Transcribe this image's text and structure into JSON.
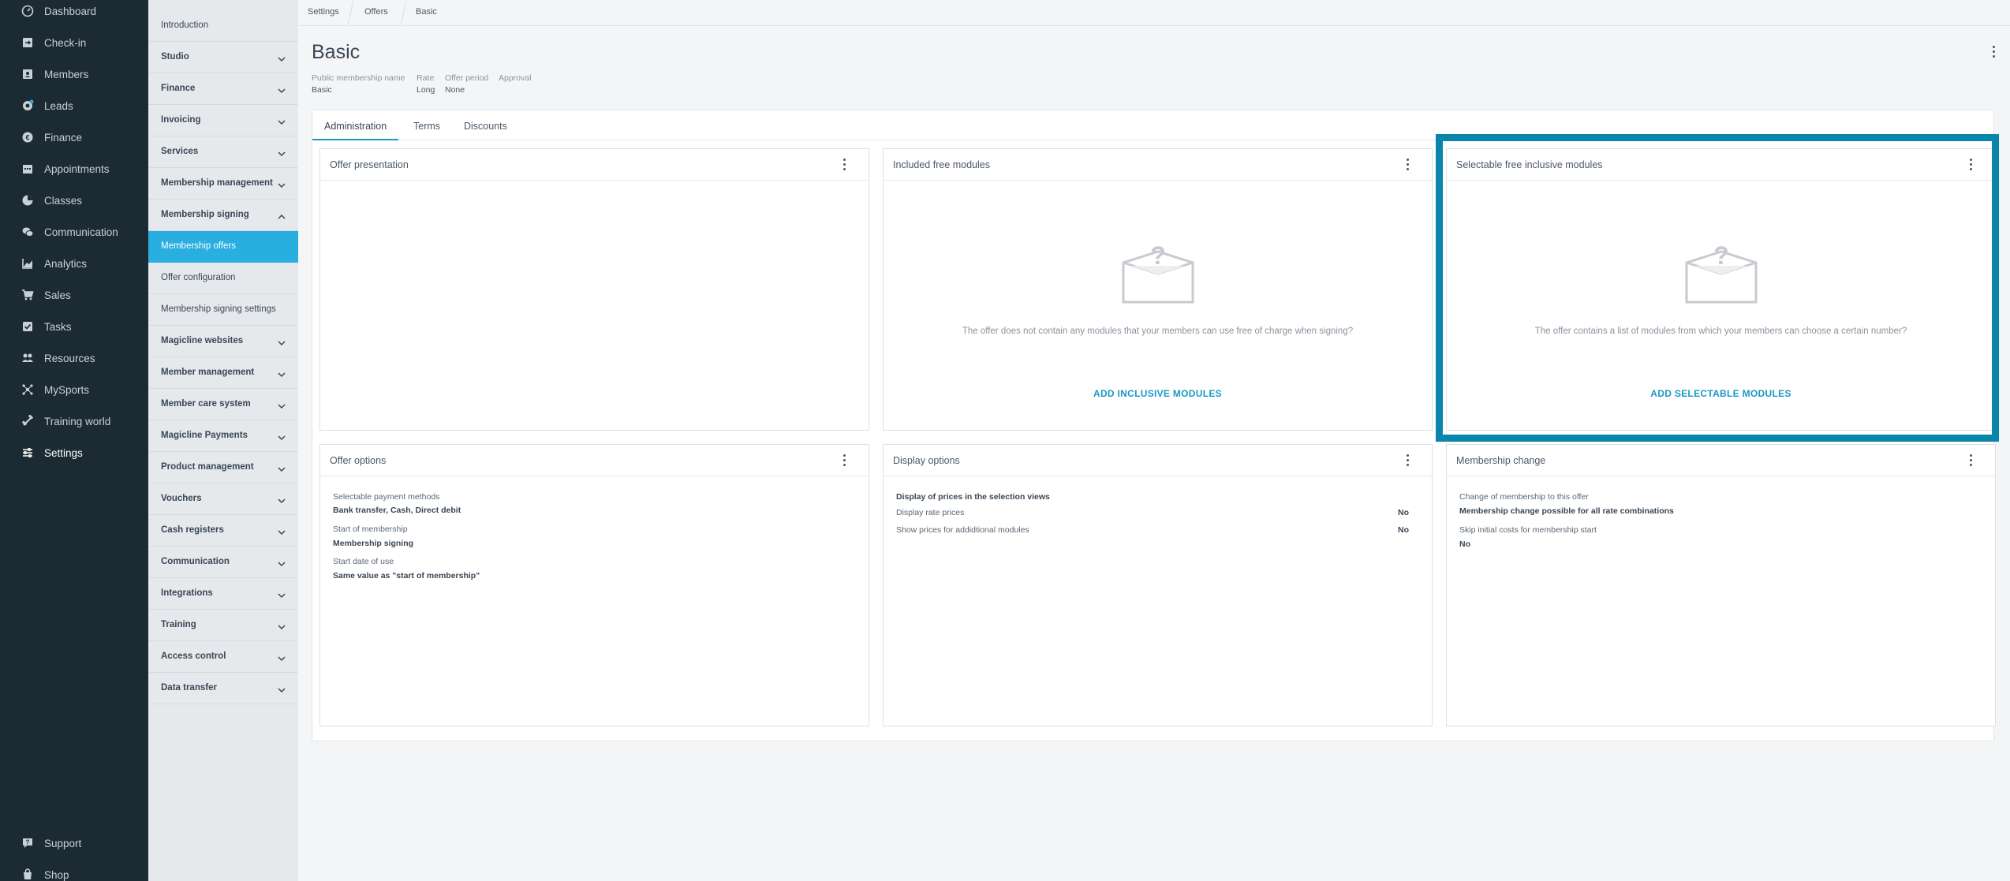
{
  "nav": {
    "items": [
      {
        "label": "Dashboard",
        "icon": "dashboard-icon"
      },
      {
        "label": "Check-in",
        "icon": "check-in-icon"
      },
      {
        "label": "Members",
        "icon": "members-icon"
      },
      {
        "label": "Leads",
        "icon": "leads-icon"
      },
      {
        "label": "Finance",
        "icon": "finance-icon"
      },
      {
        "label": "Appointments",
        "icon": "calendar-icon"
      },
      {
        "label": "Classes",
        "icon": "classes-icon"
      },
      {
        "label": "Communication",
        "icon": "chat-icon"
      },
      {
        "label": "Analytics",
        "icon": "analytics-icon"
      },
      {
        "label": "Sales",
        "icon": "cart-icon"
      },
      {
        "label": "Tasks",
        "icon": "tasks-icon"
      },
      {
        "label": "Resources",
        "icon": "resources-icon"
      },
      {
        "label": "MySports",
        "icon": "mysports-icon"
      },
      {
        "label": "Training world",
        "icon": "training-icon"
      },
      {
        "label": "Settings",
        "icon": "settings-icon"
      }
    ],
    "bottom": [
      {
        "label": "Support",
        "icon": "support-icon"
      },
      {
        "label": "Shop",
        "icon": "shop-icon"
      }
    ]
  },
  "subnav": {
    "items": [
      {
        "label": "Introduction",
        "type": "plain"
      },
      {
        "label": "Studio",
        "type": "group"
      },
      {
        "label": "Finance",
        "type": "group"
      },
      {
        "label": "Invoicing",
        "type": "group"
      },
      {
        "label": "Services",
        "type": "group"
      },
      {
        "label": "Membership management",
        "type": "group"
      },
      {
        "label": "Membership signing",
        "type": "group-open"
      },
      {
        "label": "Membership offers",
        "type": "active"
      },
      {
        "label": "Offer configuration",
        "type": "child"
      },
      {
        "label": "Membership signing settings",
        "type": "child"
      },
      {
        "label": "Magicline websites",
        "type": "group"
      },
      {
        "label": "Member management",
        "type": "group"
      },
      {
        "label": "Member care system",
        "type": "group"
      },
      {
        "label": "Magicline Payments",
        "type": "group"
      },
      {
        "label": "Product management",
        "type": "group"
      },
      {
        "label": "Vouchers",
        "type": "group"
      },
      {
        "label": "Cash registers",
        "type": "group"
      },
      {
        "label": "Communication",
        "type": "group"
      },
      {
        "label": "Integrations",
        "type": "group"
      },
      {
        "label": "Training",
        "type": "group"
      },
      {
        "label": "Access control",
        "type": "group"
      },
      {
        "label": "Data transfer",
        "type": "group"
      }
    ]
  },
  "breadcrumb": [
    "Settings",
    "Offers",
    "Basic"
  ],
  "header": {
    "title": "Basic",
    "meta": [
      {
        "label": "Public membership name",
        "value": "Basic"
      },
      {
        "label": "Rate",
        "value": "Long"
      },
      {
        "label": "Offer period",
        "value": "None"
      },
      {
        "label": "Approval",
        "value": ""
      }
    ]
  },
  "tabs": [
    {
      "label": "Administration",
      "active": true
    },
    {
      "label": "Terms",
      "active": false
    },
    {
      "label": "Discounts",
      "active": false
    }
  ],
  "cards": {
    "offer_presentation": {
      "title": "Offer presentation"
    },
    "included_free": {
      "title": "Included free modules",
      "empty_text": "The offer does not contain any modules that your members can use free of charge when signing?",
      "action": "ADD INCLUSIVE MODULES"
    },
    "selectable_free": {
      "title": "Selectable free inclusive modules",
      "empty_text": "The offer contains a list of modules from which your members can choose a certain number?",
      "action": "ADD SELECTABLE MODULES"
    },
    "offer_options": {
      "title": "Offer options",
      "rows": [
        {
          "label": "Selectable payment methods",
          "value": "Bank transfer, Cash, Direct debit"
        },
        {
          "label": "Start of membership",
          "value": "Membership signing"
        },
        {
          "label": "Start date of use",
          "value": "Same value as \"start of membership\""
        }
      ]
    },
    "display_options": {
      "title": "Display options",
      "section": "Display of prices in the selection views",
      "rows": [
        {
          "label": "Display rate prices",
          "value": "No"
        },
        {
          "label": "Show prices for addidtional modules",
          "value": "No"
        }
      ]
    },
    "membership_change": {
      "title": "Membership change",
      "rows": [
        {
          "label": "Change of membership to this offer",
          "value": "Membership change possible for all rate combinations"
        },
        {
          "label": "Skip initial costs for membership start",
          "value": "No"
        }
      ]
    }
  },
  "colors": {
    "nav_bg": "#1c2a33",
    "accent": "#29aee0",
    "link": "#1a98c3",
    "highlight": "#0a86ad"
  }
}
